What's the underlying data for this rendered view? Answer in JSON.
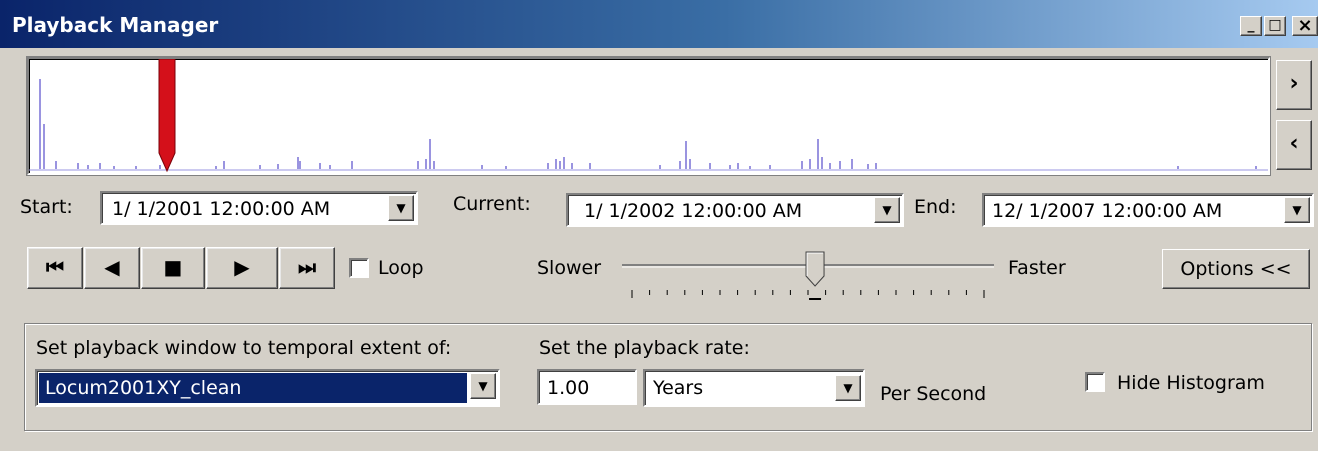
{
  "window": {
    "title": "Playback Manager",
    "minimize_glyph": "_",
    "maximize_glyph": "□",
    "close_glyph": "×"
  },
  "histogram": {
    "current_marker_color": "#d4101a",
    "bar_color": "#9a94e0"
  },
  "nav": {
    "forward_glyph": "›",
    "back_glyph": "‹"
  },
  "time_range": {
    "start_label": "Start:",
    "start_value": "1/  1/2001 12:00:00 AM",
    "current_label": "Current:",
    "current_value": "1/  1/2002 12:00:00 AM",
    "end_label": "End:",
    "end_value": "12/  1/2007 12:00:00 AM"
  },
  "transport": {
    "first_glyph": "⏮",
    "prev_glyph": "◀",
    "stop_glyph": "■",
    "play_glyph": "▶",
    "last_glyph": "⏭",
    "loop_label": "Loop",
    "loop_checked": false
  },
  "speed": {
    "slower_label": "Slower",
    "faster_label": "Faster",
    "level": 0.52
  },
  "options_button": "Options <<",
  "options": {
    "extent_label": "Set playback window to temporal extent of:",
    "extent_value": "Locum2001XY_clean",
    "rate_label": "Set the playback rate:",
    "rate_value": "1.00",
    "rate_unit": "Years",
    "per_second_label": "Per Second",
    "hide_histogram_label": "Hide Histogram",
    "hide_histogram_checked": false
  }
}
